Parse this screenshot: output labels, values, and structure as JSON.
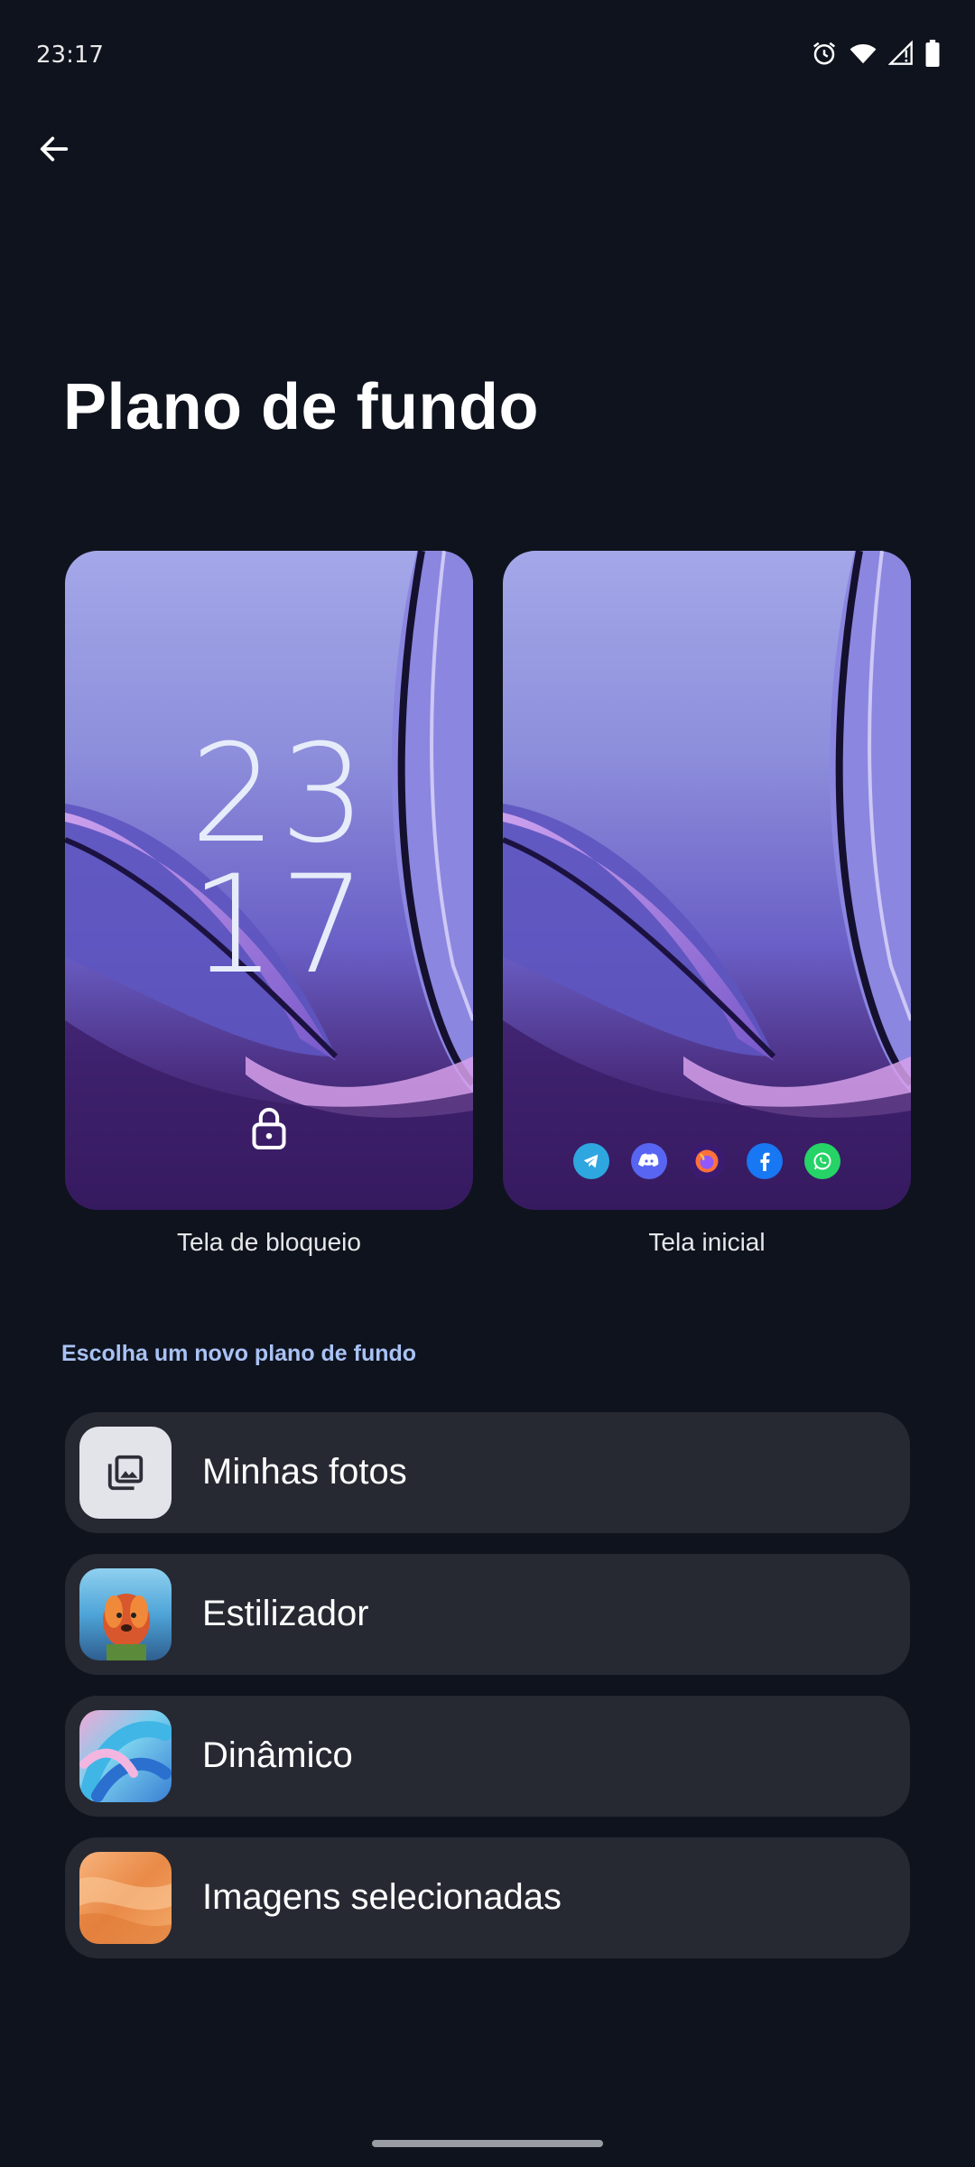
{
  "status_bar": {
    "time": "23:17",
    "icons": [
      "alarm-icon",
      "wifi-icon",
      "signal-icon",
      "battery-icon"
    ]
  },
  "header": {
    "back_icon": "arrow-left-icon",
    "title": "Plano de fundo"
  },
  "previews": {
    "lock_screen": {
      "clock_hour": "23",
      "clock_minute": "17",
      "icon": "lock-icon",
      "label": "Tela de bloqueio"
    },
    "home_screen": {
      "label": "Tela inicial",
      "dock_apps": [
        "telegram-icon",
        "discord-icon",
        "firefox-icon",
        "facebook-icon",
        "whatsapp-icon"
      ]
    }
  },
  "section": {
    "heading": "Escolha um novo plano de fundo"
  },
  "options": [
    {
      "label": "Minhas fotos",
      "icon": "gallery-icon"
    },
    {
      "label": "Estilizador",
      "icon": "stylizer-thumbnail"
    },
    {
      "label": "Dinâmico",
      "icon": "dynamic-thumbnail"
    },
    {
      "label": "Imagens selecionadas",
      "icon": "curated-thumbnail"
    }
  ],
  "colors": {
    "background": "#0f131d",
    "card": "#262932",
    "accent_heading": "#a9c2f5"
  }
}
